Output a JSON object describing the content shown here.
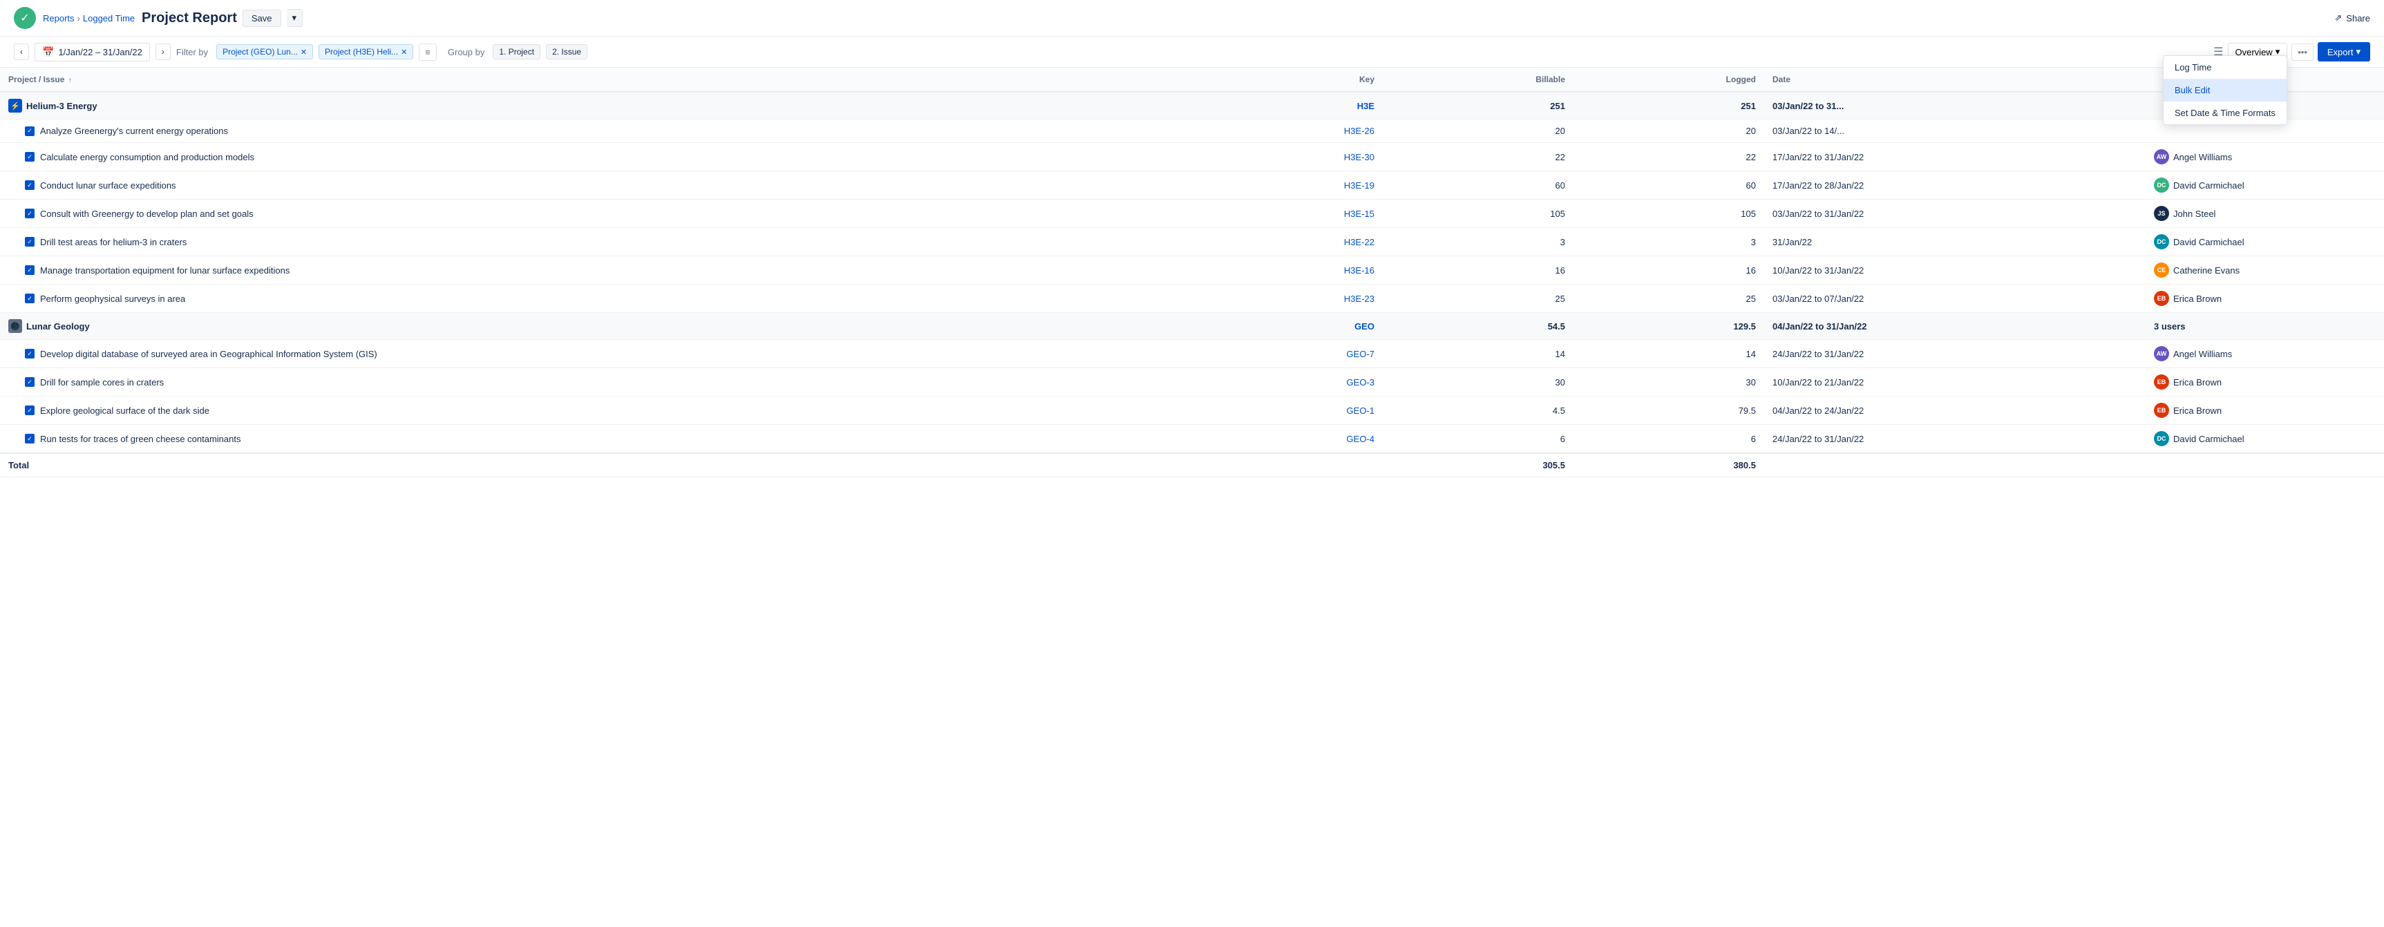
{
  "header": {
    "breadcrumb_link": "Reports",
    "breadcrumb_sep": "›",
    "breadcrumb_sub": "Logged Time",
    "page_title": "Project Report",
    "save_label": "Save",
    "share_label": "Share"
  },
  "toolbar": {
    "prev_label": "‹",
    "next_label": "›",
    "date_range": "1/Jan/22 – 31/Jan/22",
    "filter_label": "Filter by",
    "filter1": "Project (GEO) Lun...",
    "filter2": "Project (H3E) Heli...",
    "group_label": "Group by",
    "group1": "1. Project",
    "group2": "2. Issue",
    "overview_label": "Overview",
    "export_label": "Export"
  },
  "columns": {
    "project_issue": "Project / Issue",
    "key": "Key",
    "billable": "Billable",
    "logged": "Logged",
    "date": "Date",
    "user": ""
  },
  "dropdown_menu": {
    "items": [
      {
        "label": "Log Time",
        "active": false
      },
      {
        "label": "Bulk Edit",
        "active": true
      },
      {
        "label": "Set Date & Time Formats",
        "active": false
      }
    ]
  },
  "projects": [
    {
      "name": "Helium-3 Energy",
      "icon": "⚡",
      "icon_class": "blue",
      "key": "H3E",
      "billable": "251",
      "logged": "251",
      "date": "03/Jan/22 to 31...",
      "user": "",
      "issues": [
        {
          "name": "Analyze Greenergy's current energy operations",
          "key": "H3E-26",
          "billable": "20",
          "logged": "20",
          "date": "03/Jan/22 to 14/...",
          "user": "",
          "avatar_class": "",
          "avatar_initials": ""
        },
        {
          "name": "Calculate energy consumption and production models",
          "key": "H3E-30",
          "billable": "22",
          "logged": "22",
          "date": "17/Jan/22 to 31/Jan/22",
          "user": "Angel Williams",
          "avatar_class": "av-purple",
          "avatar_initials": "AW"
        },
        {
          "name": "Conduct lunar surface expeditions",
          "key": "H3E-19",
          "billable": "60",
          "logged": "60",
          "date": "17/Jan/22 to 28/Jan/22",
          "user": "David Carmichael",
          "avatar_class": "av-green",
          "avatar_initials": "DC"
        },
        {
          "name": "Consult with Greenergy to develop plan and set goals",
          "key": "H3E-15",
          "billable": "105",
          "logged": "105",
          "date": "03/Jan/22 to 31/Jan/22",
          "user": "John Steel",
          "avatar_class": "av-dark",
          "avatar_initials": "JS"
        },
        {
          "name": "Drill test areas for helium-3 in craters",
          "key": "H3E-22",
          "billable": "3",
          "logged": "3",
          "date": "31/Jan/22",
          "user": "David Carmichael",
          "avatar_class": "av-teal",
          "avatar_initials": "DC"
        },
        {
          "name": "Manage transportation equipment for lunar surface expeditions",
          "key": "H3E-16",
          "billable": "16",
          "logged": "16",
          "date": "10/Jan/22 to 31/Jan/22",
          "user": "Catherine Evans",
          "avatar_class": "av-orange",
          "avatar_initials": "CE"
        },
        {
          "name": "Perform geophysical surveys in area",
          "key": "H3E-23",
          "billable": "25",
          "logged": "25",
          "date": "03/Jan/22 to 07/Jan/22",
          "user": "Erica Brown",
          "avatar_class": "av-red",
          "avatar_initials": "EB"
        }
      ]
    },
    {
      "name": "Lunar Geology",
      "icon": "🌑",
      "icon_class": "gray",
      "key": "GEO",
      "billable": "54.5",
      "logged": "129.5",
      "date": "04/Jan/22 to 31/Jan/22",
      "user": "3 users",
      "issues": [
        {
          "name": "Develop digital database of surveyed area in Geographical Information System (GIS)",
          "key": "GEO-7",
          "billable": "14",
          "logged": "14",
          "date": "24/Jan/22 to 31/Jan/22",
          "user": "Angel Williams",
          "avatar_class": "av-purple",
          "avatar_initials": "AW"
        },
        {
          "name": "Drill for sample cores in craters",
          "key": "GEO-3",
          "billable": "30",
          "logged": "30",
          "date": "10/Jan/22 to 21/Jan/22",
          "user": "Erica Brown",
          "avatar_class": "av-red",
          "avatar_initials": "EB"
        },
        {
          "name": "Explore geological surface of the dark side",
          "key": "GEO-1",
          "billable": "4.5",
          "logged": "79.5",
          "date": "04/Jan/22 to 24/Jan/22",
          "user": "Erica Brown",
          "avatar_class": "av-red",
          "avatar_initials": "EB"
        },
        {
          "name": "Run tests for traces of green cheese contaminants",
          "key": "GEO-4",
          "billable": "6",
          "logged": "6",
          "date": "24/Jan/22 to 31/Jan/22",
          "user": "David Carmichael",
          "avatar_class": "av-teal",
          "avatar_initials": "DC"
        }
      ]
    }
  ],
  "totals": {
    "label": "Total",
    "billable": "305.5",
    "logged": "380.5"
  }
}
